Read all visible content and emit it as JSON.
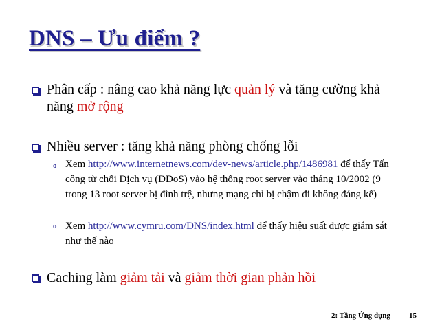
{
  "title": "DNS – Ưu điểm ?",
  "bullets": [
    {
      "prefix": "Phân cấp : nâng cao khả năng lực ",
      "highlight1": "quản lý",
      "middle": " và tăng cường khả năng ",
      "highlight2": "mở rộng"
    },
    {
      "text": "Nhiều server : tăng khả năng phòng chống lỗi",
      "subs": [
        {
          "pre": "Xem ",
          "link": "http://www.internetnews.com/dev-news/article.php/1486981",
          "post": " để thấy Tấn công từ chối Dịch vụ (DDoS) vào hệ thống root server vào tháng 10/2002 (9 trong 13 root server bị đình trệ, nhưng mạng chỉ bị chậm đi không đáng kể)"
        },
        {
          "pre": "Xem ",
          "link": "http://www.cymru.com/DNS/index.html",
          "post": " để thấy hiệu suất được giám sát như thế nào"
        }
      ]
    },
    {
      "prefix": "Caching làm ",
      "highlight1": "giảm tải",
      "middle": " và ",
      "highlight2": "giảm thời gian phản hồi"
    }
  ],
  "sub_bullet_glyph": "o",
  "footer": {
    "label": "2: Tầng Ứng dụng",
    "page": "15"
  },
  "colors": {
    "title": "#1f1f8f",
    "highlight": "#cc1111",
    "link": "#2a2a9a"
  }
}
